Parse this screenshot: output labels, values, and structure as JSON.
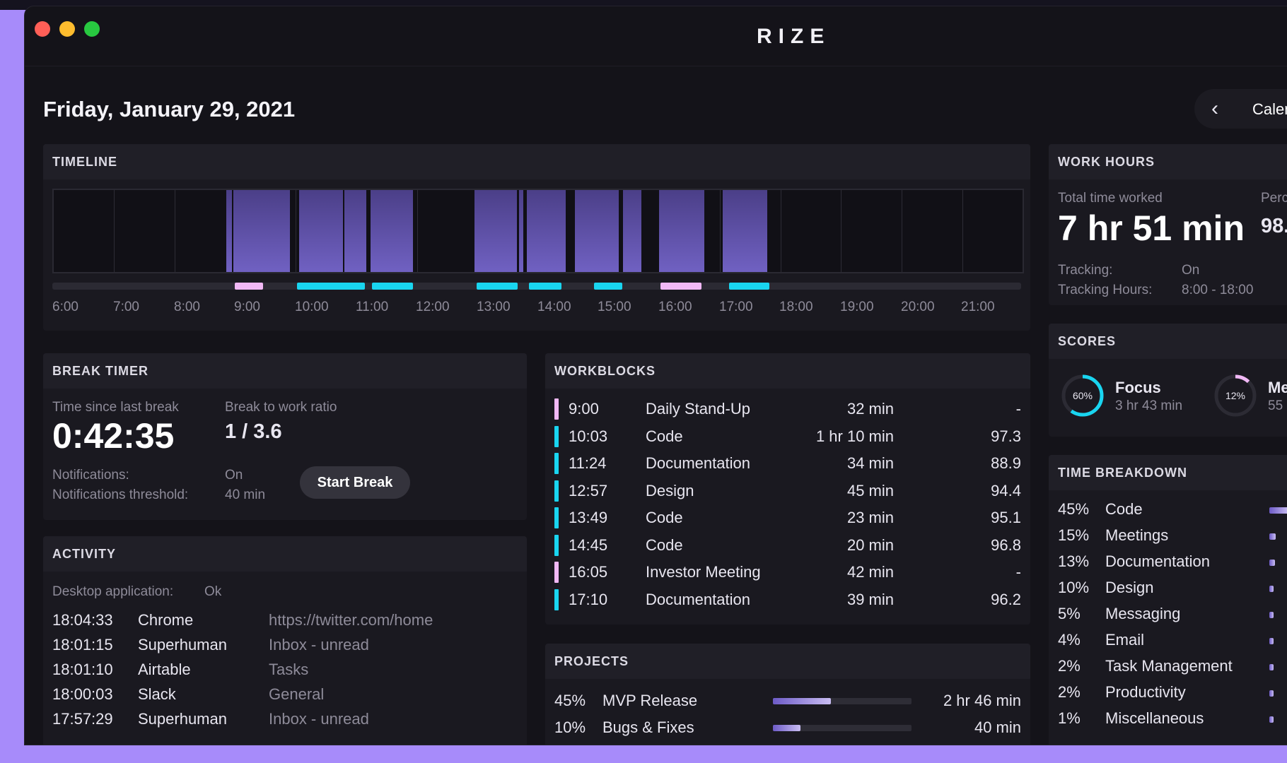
{
  "app": {
    "title": "RIZE",
    "colors": {
      "accent": "#7161c7",
      "cyan": "#19d5f0",
      "pink": "#f1b8f5",
      "background": "#141319"
    }
  },
  "header": {
    "date": "Friday, January 29, 2021",
    "calendar_label": "Calen",
    "back_icon": "chevron-left-icon"
  },
  "timeline": {
    "title": "TIMELINE",
    "ticks": [
      "6:00",
      "7:00",
      "8:00",
      "9:00",
      "10:00",
      "11:00",
      "12:00",
      "13:00",
      "14:00",
      "15:00",
      "16:00",
      "17:00",
      "18:00",
      "19:00",
      "20:00",
      "21:00"
    ]
  },
  "break_timer": {
    "title": "BREAK TIMER",
    "time_since_label": "Time since last break",
    "time_since_value": "0:42:35",
    "ratio_label": "Break to work ratio",
    "ratio_value": "1 / 3.6",
    "notifications_label": "Notifications:",
    "notifications_value": "On",
    "threshold_label": "Notifications threshold:",
    "threshold_value": "40 min",
    "start_break_label": "Start Break"
  },
  "activity": {
    "title": "ACTIVITY",
    "desktop_label": "Desktop application:",
    "desktop_value": "Ok",
    "rows": [
      {
        "time": "18:04:33",
        "app": "Chrome",
        "detail": "https://twitter.com/home"
      },
      {
        "time": "18:01:15",
        "app": "Superhuman",
        "detail": "Inbox - unread"
      },
      {
        "time": "18:01:10",
        "app": "Airtable",
        "detail": "Tasks"
      },
      {
        "time": "18:00:03",
        "app": "Slack",
        "detail": "General"
      },
      {
        "time": "17:57:29",
        "app": "Superhuman",
        "detail": "Inbox - unread"
      }
    ]
  },
  "workblocks": {
    "title": "WORKBLOCKS",
    "rows": [
      {
        "time": "9:00",
        "name": "Daily Stand-Up",
        "duration": "32 min",
        "score": "-",
        "color": "#f1b8f5"
      },
      {
        "time": "10:03",
        "name": "Code",
        "duration": "1 hr 10 min",
        "score": "97.3",
        "color": "#19d5f0"
      },
      {
        "time": "11:24",
        "name": "Documentation",
        "duration": "34 min",
        "score": "88.9",
        "color": "#19d5f0"
      },
      {
        "time": "12:57",
        "name": "Design",
        "duration": "45 min",
        "score": "94.4",
        "color": "#19d5f0"
      },
      {
        "time": "13:49",
        "name": "Code",
        "duration": "23 min",
        "score": "95.1",
        "color": "#19d5f0"
      },
      {
        "time": "14:45",
        "name": "Code",
        "duration": "20 min",
        "score": "96.8",
        "color": "#19d5f0"
      },
      {
        "time": "16:05",
        "name": "Investor Meeting",
        "duration": "42 min",
        "score": "-",
        "color": "#f1b8f5"
      },
      {
        "time": "17:10",
        "name": "Documentation",
        "duration": "39 min",
        "score": "96.2",
        "color": "#19d5f0"
      }
    ]
  },
  "projects": {
    "title": "PROJECTS",
    "rows": [
      {
        "percent": "45%",
        "name": "MVP Release",
        "time": "2 hr 46 min",
        "fill": 0.42
      },
      {
        "percent": "10%",
        "name": "Bugs & Fixes",
        "time": "40 min",
        "fill": 0.2
      }
    ]
  },
  "work_hours": {
    "title": "WORK HOURS",
    "total_label": "Total time worked",
    "total_value": "7 hr 51 min",
    "percent_label": "Perce",
    "percent_value": "98.",
    "tracking_label": "Tracking:",
    "tracking_value": "On",
    "tracking_hours_label": "Tracking Hours:",
    "tracking_hours_value": "8:00 - 18:00"
  },
  "scores": {
    "title": "SCORES",
    "items": [
      {
        "percent": "60%",
        "name": "Focus",
        "time": "3 hr 43 min",
        "fraction": 0.6
      },
      {
        "percent": "12%",
        "name": "Me",
        "time": "55",
        "fraction": 0.12
      }
    ]
  },
  "time_breakdown": {
    "title": "TIME BREAKDOWN",
    "rows": [
      {
        "percent": "45%",
        "name": "Code",
        "fraction": 0.45
      },
      {
        "percent": "15%",
        "name": "Meetings",
        "fraction": 0.15
      },
      {
        "percent": "13%",
        "name": "Documentation",
        "fraction": 0.13
      },
      {
        "percent": "10%",
        "name": "Design",
        "fraction": 0.1
      },
      {
        "percent": "5%",
        "name": "Messaging",
        "fraction": 0.05
      },
      {
        "percent": "4%",
        "name": "Email",
        "fraction": 0.04
      },
      {
        "percent": "2%",
        "name": "Task Management",
        "fraction": 0.02
      },
      {
        "percent": "2%",
        "name": "Productivity",
        "fraction": 0.02
      },
      {
        "percent": "1%",
        "name": "Miscellaneous",
        "fraction": 0.01
      }
    ]
  }
}
